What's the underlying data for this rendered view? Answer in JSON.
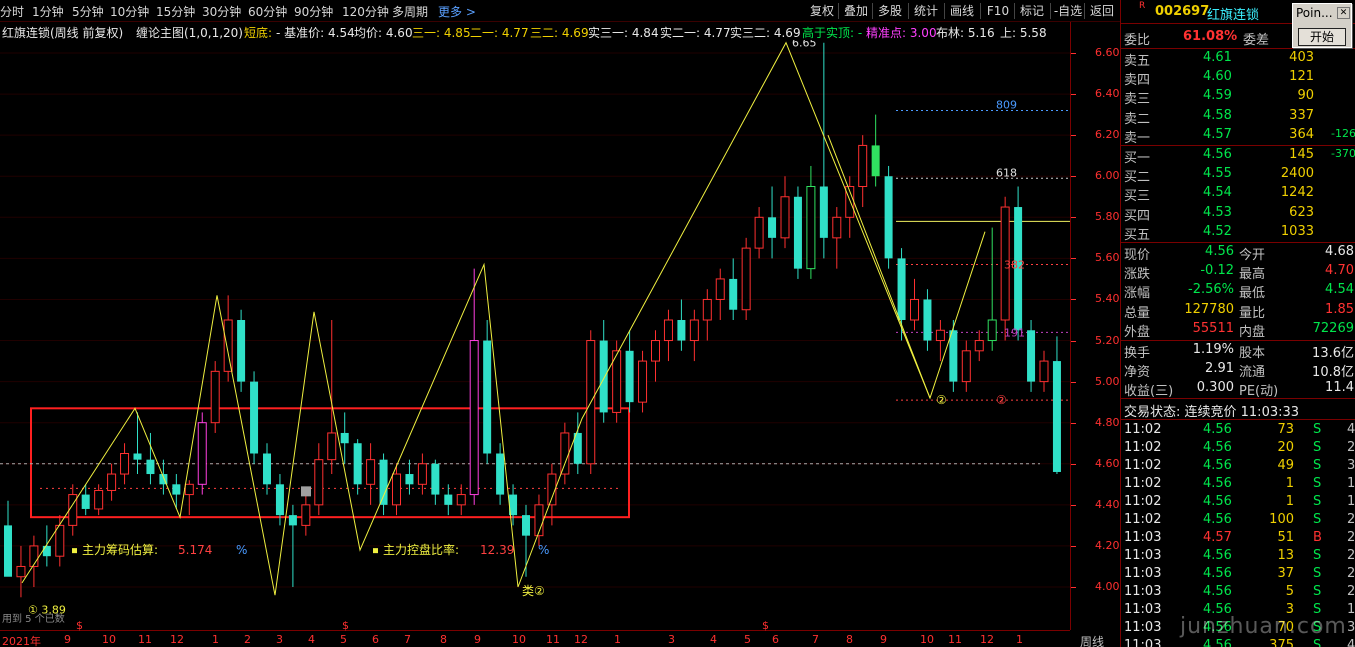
{
  "toolbar": {
    "periods": [
      "分时",
      "1分钟",
      "5分钟",
      "10分钟",
      "15分钟",
      "30分钟",
      "60分钟",
      "90分钟",
      "120分钟",
      "多周期"
    ],
    "more": "更多 >",
    "buttons": [
      "复权",
      "叠加",
      "多股",
      "统计",
      "画线",
      "F10",
      "标记",
      "-自选",
      "返回"
    ]
  },
  "infoline": {
    "title": "红旗连锁(周线 前复权)",
    "indicator": "缠论主图(1,0,1,20)",
    "short_bottom": "短底:",
    "base_price": "- 基准价: 4.54",
    "avg_price": "均价: 4.60",
    "san_yi": "三一: 4.85",
    "er_yi": "二一: 4.77",
    "san_er": "三二: 4.69",
    "shi_san_yi": "实三一: 4.84",
    "shi_er_yi": "实二一: 4.77",
    "shi_san_er": "实三二: 4.69",
    "above_real": "高于实顶: -",
    "precise_point": "精准点: 3.00",
    "bollinger": "布林: 5.16",
    "upper": "上: 5.58"
  },
  "chart_labels": {
    "high_label": "6.65",
    "low_label": "① 3.89",
    "fib_809": "809",
    "fib_618": "618",
    "fib_382": "382",
    "fib_191": "191",
    "lei2": "类②",
    "circle2": "②",
    "circle_right": "②",
    "chip_label": "主力筹码估算:",
    "chip_value": "5.174",
    "chip_pct": "%",
    "control_label": "主力控盘比率:",
    "control_value": "12.39",
    "control_pct": "%",
    "used_label": "用到 5 个已数"
  },
  "yaxis": [
    "6.60",
    "6.40",
    "6.20",
    "6.00",
    "5.80",
    "5.60",
    "5.40",
    "5.20",
    "5.00",
    "4.80",
    "4.60",
    "4.40",
    "4.20",
    "4.00"
  ],
  "xaxis": {
    "labels": [
      "2021年",
      "9",
      "10",
      "11",
      "12",
      "1",
      "2",
      "3",
      "4",
      "5",
      "6",
      "7",
      "8",
      "9",
      "10",
      "11",
      "12",
      "1",
      "3",
      "4",
      "5",
      "6",
      "7",
      "8",
      "9",
      "10",
      "11",
      "12",
      "1"
    ],
    "marks": [
      "$",
      "$",
      "$"
    ],
    "period": "周线"
  },
  "panel": {
    "code": "002697",
    "name": "红旗连锁",
    "r_tag": "R",
    "weibi_label": "委比",
    "weibi_value": "61.08%",
    "weicha_label": "委差",
    "asks": [
      {
        "label": "卖五",
        "price": "4.61",
        "vol": "403",
        "chg": ""
      },
      {
        "label": "卖四",
        "price": "4.60",
        "vol": "121",
        "chg": ""
      },
      {
        "label": "卖三",
        "price": "4.59",
        "vol": "90",
        "chg": ""
      },
      {
        "label": "卖二",
        "price": "4.58",
        "vol": "337",
        "chg": ""
      },
      {
        "label": "卖一",
        "price": "4.57",
        "vol": "364",
        "chg": "-126"
      }
    ],
    "bids": [
      {
        "label": "买一",
        "price": "4.56",
        "vol": "145",
        "chg": "-370"
      },
      {
        "label": "买二",
        "price": "4.55",
        "vol": "2400",
        "chg": ""
      },
      {
        "label": "买三",
        "price": "4.54",
        "vol": "1242",
        "chg": ""
      },
      {
        "label": "买四",
        "price": "4.53",
        "vol": "623",
        "chg": ""
      },
      {
        "label": "买五",
        "price": "4.52",
        "vol": "1033",
        "chg": ""
      }
    ],
    "stats": [
      {
        "l1": "现价",
        "v1": "4.56",
        "l2": "今开",
        "v2": "4.68",
        "c1": "green",
        "c2": "white"
      },
      {
        "l1": "涨跌",
        "v1": "-0.12",
        "l2": "最高",
        "v2": "4.70",
        "c1": "green",
        "c2": "red"
      },
      {
        "l1": "涨幅",
        "v1": "-2.56%",
        "l2": "最低",
        "v2": "4.54",
        "c1": "green",
        "c2": "green"
      },
      {
        "l1": "总量",
        "v1": "127780",
        "l2": "量比",
        "v2": "1.85",
        "c1": "yellow",
        "c2": "red"
      },
      {
        "l1": "外盘",
        "v1": "55511",
        "l2": "内盘",
        "v2": "72269",
        "c1": "red",
        "c2": "green"
      }
    ],
    "stats2": [
      {
        "l1": "换手",
        "v1": "1.19%",
        "l2": "股本",
        "v2": "13.6亿"
      },
      {
        "l1": "净资",
        "v1": "2.91",
        "l2": "流通",
        "v2": "10.8亿"
      },
      {
        "l1": "收益(三)",
        "v1": "0.300",
        "l2": "PE(动)",
        "v2": "11.4"
      }
    ],
    "trade_status": "交易状态: 连续竞价 11:03:33",
    "ticks": [
      {
        "t": "11:02",
        "p": "4.56",
        "v": "73",
        "s": "S",
        "n": "4"
      },
      {
        "t": "11:02",
        "p": "4.56",
        "v": "20",
        "s": "S",
        "n": "2"
      },
      {
        "t": "11:02",
        "p": "4.56",
        "v": "49",
        "s": "S",
        "n": "3"
      },
      {
        "t": "11:02",
        "p": "4.56",
        "v": "1",
        "s": "S",
        "n": "1"
      },
      {
        "t": "11:02",
        "p": "4.56",
        "v": "1",
        "s": "S",
        "n": "1"
      },
      {
        "t": "11:02",
        "p": "4.56",
        "v": "100",
        "s": "S",
        "n": "2"
      },
      {
        "t": "11:03",
        "p": "4.57",
        "v": "51",
        "s": "B",
        "n": "2"
      },
      {
        "t": "11:03",
        "p": "4.56",
        "v": "13",
        "s": "S",
        "n": "2"
      },
      {
        "t": "11:03",
        "p": "4.56",
        "v": "37",
        "s": "S",
        "n": "2"
      },
      {
        "t": "11:03",
        "p": "4.56",
        "v": "5",
        "s": "S",
        "n": "2"
      },
      {
        "t": "11:03",
        "p": "4.56",
        "v": "3",
        "s": "S",
        "n": "1"
      },
      {
        "t": "11:03",
        "p": "4.56",
        "v": "70",
        "s": "S",
        "n": "3"
      },
      {
        "t": "11:03",
        "p": "4.56",
        "v": "375",
        "s": "S",
        "n": "4"
      }
    ]
  },
  "popup": {
    "title": "Poin...",
    "close": "✕",
    "button": "开始"
  },
  "watermark": "junzhuan.com",
  "chart_data": {
    "type": "candlestick",
    "ylim": [
      3.9,
      6.7
    ],
    "ohlc": [
      [
        4.3,
        4.42,
        4.1,
        4.05
      ],
      [
        4.05,
        4.2,
        3.95,
        4.1
      ],
      [
        4.1,
        4.25,
        4.0,
        4.2
      ],
      [
        4.2,
        4.3,
        4.1,
        4.15
      ],
      [
        4.15,
        4.35,
        4.1,
        4.3
      ],
      [
        4.3,
        4.5,
        4.25,
        4.45
      ],
      [
        4.45,
        4.5,
        4.35,
        4.38
      ],
      [
        4.38,
        4.5,
        4.35,
        4.47
      ],
      [
        4.47,
        4.6,
        4.42,
        4.55
      ],
      [
        4.55,
        4.7,
        4.5,
        4.65
      ],
      [
        4.65,
        4.85,
        4.55,
        4.62
      ],
      [
        4.62,
        4.75,
        4.5,
        4.55
      ],
      [
        4.55,
        4.62,
        4.45,
        4.5
      ],
      [
        4.5,
        4.55,
        4.38,
        4.45
      ],
      [
        4.45,
        4.52,
        4.35,
        4.5
      ],
      [
        4.5,
        4.85,
        4.45,
        4.8
      ],
      [
        4.8,
        5.1,
        4.75,
        5.05
      ],
      [
        5.05,
        5.42,
        5.0,
        5.3
      ],
      [
        5.3,
        5.35,
        4.95,
        5.0
      ],
      [
        5.0,
        5.05,
        4.6,
        4.65
      ],
      [
        4.65,
        4.7,
        4.45,
        4.5
      ],
      [
        4.5,
        4.55,
        4.3,
        4.35
      ],
      [
        4.35,
        4.4,
        4.0,
        4.3
      ],
      [
        4.3,
        4.45,
        4.25,
        4.4
      ],
      [
        4.4,
        4.7,
        4.35,
        4.62
      ],
      [
        4.62,
        5.3,
        4.55,
        4.75
      ],
      [
        4.75,
        4.85,
        4.6,
        4.7
      ],
      [
        4.7,
        4.72,
        4.45,
        4.5
      ],
      [
        4.5,
        4.7,
        4.4,
        4.62
      ],
      [
        4.62,
        4.65,
        4.35,
        4.4
      ],
      [
        4.4,
        4.6,
        4.35,
        4.55
      ],
      [
        4.55,
        4.62,
        4.45,
        4.5
      ],
      [
        4.5,
        4.65,
        4.45,
        4.6
      ],
      [
        4.6,
        4.62,
        4.4,
        4.45
      ],
      [
        4.45,
        4.5,
        4.35,
        4.4
      ],
      [
        4.4,
        4.5,
        4.35,
        4.45
      ],
      [
        4.45,
        5.55,
        4.4,
        5.2
      ],
      [
        5.2,
        5.3,
        4.6,
        4.65
      ],
      [
        4.65,
        4.7,
        4.4,
        4.45
      ],
      [
        4.45,
        4.5,
        4.3,
        4.35
      ],
      [
        4.35,
        4.4,
        4.05,
        4.25
      ],
      [
        4.25,
        4.45,
        4.2,
        4.4
      ],
      [
        4.4,
        4.6,
        4.3,
        4.55
      ],
      [
        4.55,
        4.8,
        4.5,
        4.75
      ],
      [
        4.75,
        4.85,
        4.55,
        4.6
      ],
      [
        4.6,
        5.25,
        4.55,
        5.2
      ],
      [
        5.2,
        5.3,
        4.8,
        4.85
      ],
      [
        4.85,
        5.2,
        4.8,
        5.15
      ],
      [
        5.15,
        5.25,
        4.85,
        4.9
      ],
      [
        4.9,
        5.15,
        4.85,
        5.1
      ],
      [
        5.1,
        5.25,
        5.0,
        5.2
      ],
      [
        5.2,
        5.35,
        5.1,
        5.3
      ],
      [
        5.3,
        5.4,
        5.15,
        5.2
      ],
      [
        5.2,
        5.35,
        5.1,
        5.3
      ],
      [
        5.3,
        5.45,
        5.2,
        5.4
      ],
      [
        5.4,
        5.55,
        5.3,
        5.5
      ],
      [
        5.5,
        5.6,
        5.3,
        5.35
      ],
      [
        5.35,
        5.7,
        5.3,
        5.65
      ],
      [
        5.65,
        5.85,
        5.6,
        5.8
      ],
      [
        5.8,
        5.95,
        5.6,
        5.7
      ],
      [
        5.7,
        6.0,
        5.65,
        5.9
      ],
      [
        5.9,
        5.95,
        5.5,
        5.55
      ],
      [
        5.55,
        6.05,
        5.5,
        5.95
      ],
      [
        5.95,
        6.65,
        5.6,
        5.7
      ],
      [
        5.7,
        5.85,
        5.55,
        5.8
      ],
      [
        5.8,
        6.0,
        5.7,
        5.95
      ],
      [
        5.95,
        6.2,
        5.85,
        6.15
      ],
      [
        6.15,
        6.3,
        5.95,
        6.0
      ],
      [
        6.0,
        6.05,
        5.55,
        5.6
      ],
      [
        5.6,
        5.65,
        5.2,
        5.3
      ],
      [
        5.3,
        5.5,
        5.25,
        5.4
      ],
      [
        5.4,
        5.45,
        5.15,
        5.2
      ],
      [
        5.2,
        5.3,
        5.1,
        5.25
      ],
      [
        5.25,
        5.3,
        4.95,
        5.0
      ],
      [
        5.0,
        5.2,
        4.95,
        5.15
      ],
      [
        5.15,
        5.25,
        5.1,
        5.2
      ],
      [
        5.2,
        5.75,
        5.15,
        5.3
      ],
      [
        5.3,
        5.9,
        5.2,
        5.85
      ],
      [
        5.85,
        5.95,
        5.2,
        5.25
      ],
      [
        5.25,
        5.3,
        4.95,
        5.0
      ],
      [
        5.0,
        5.15,
        4.95,
        5.1
      ],
      [
        5.1,
        5.22,
        4.55,
        4.56
      ]
    ]
  }
}
